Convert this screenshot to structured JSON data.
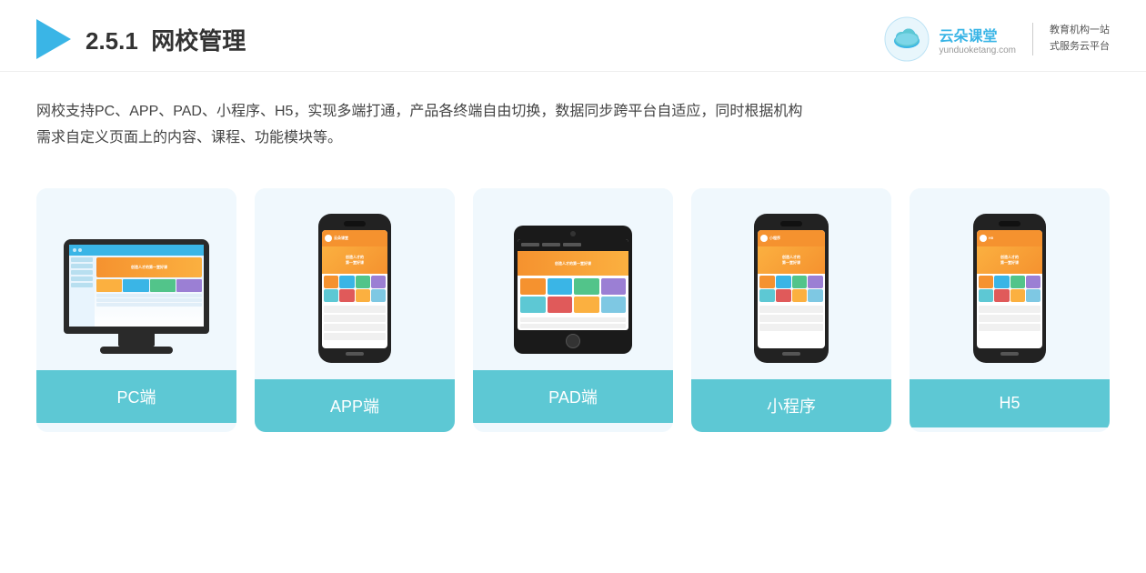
{
  "header": {
    "section_number": "2.5.1",
    "title": "网校管理",
    "brand_name": "云朵课堂",
    "brand_domain": "yunduoketang.com",
    "brand_slogan_line1": "教育机构一站",
    "brand_slogan_line2": "式服务云平台"
  },
  "description": {
    "text_line1": "网校支持PC、APP、PAD、小程序、H5，实现多端打通，产品各终端自由切换，数据同步跨平台自适应，同时根据机构",
    "text_line2": "需求自定义页面上的内容、课程、功能模块等。"
  },
  "cards": [
    {
      "id": "pc",
      "label": "PC端"
    },
    {
      "id": "app",
      "label": "APP端"
    },
    {
      "id": "pad",
      "label": "PAD端"
    },
    {
      "id": "mini",
      "label": "小程序"
    },
    {
      "id": "h5",
      "label": "H5"
    }
  ],
  "colors": {
    "accent": "#5dc8d4",
    "header_border": "#eee",
    "card_bg": "#eef7fb",
    "text_primary": "#333",
    "text_body": "#444",
    "triangle_blue": "#3ab5e6"
  }
}
